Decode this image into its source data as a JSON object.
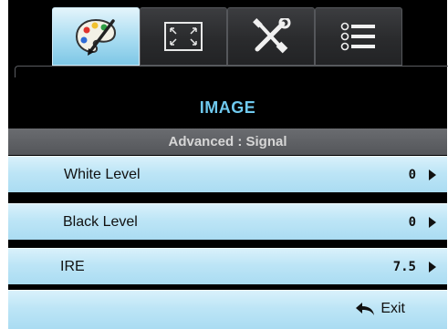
{
  "tabs": [
    {
      "name": "image-palette-icon",
      "active": true
    },
    {
      "name": "display-screen-icon",
      "active": false
    },
    {
      "name": "setup-tools-icon",
      "active": false
    },
    {
      "name": "options-list-icon",
      "active": false
    }
  ],
  "menu": {
    "title": "IMAGE",
    "subtitle": "Advanced : Signal"
  },
  "items": [
    {
      "label": "White Level",
      "value": "0"
    },
    {
      "label": "Black Level",
      "value": "0"
    },
    {
      "label": "IRE",
      "value": "7.5"
    }
  ],
  "exit_label": "Exit",
  "colors": {
    "accent": "#6fc9ee",
    "row_bg": "#bde5f6",
    "background": "#000000"
  }
}
